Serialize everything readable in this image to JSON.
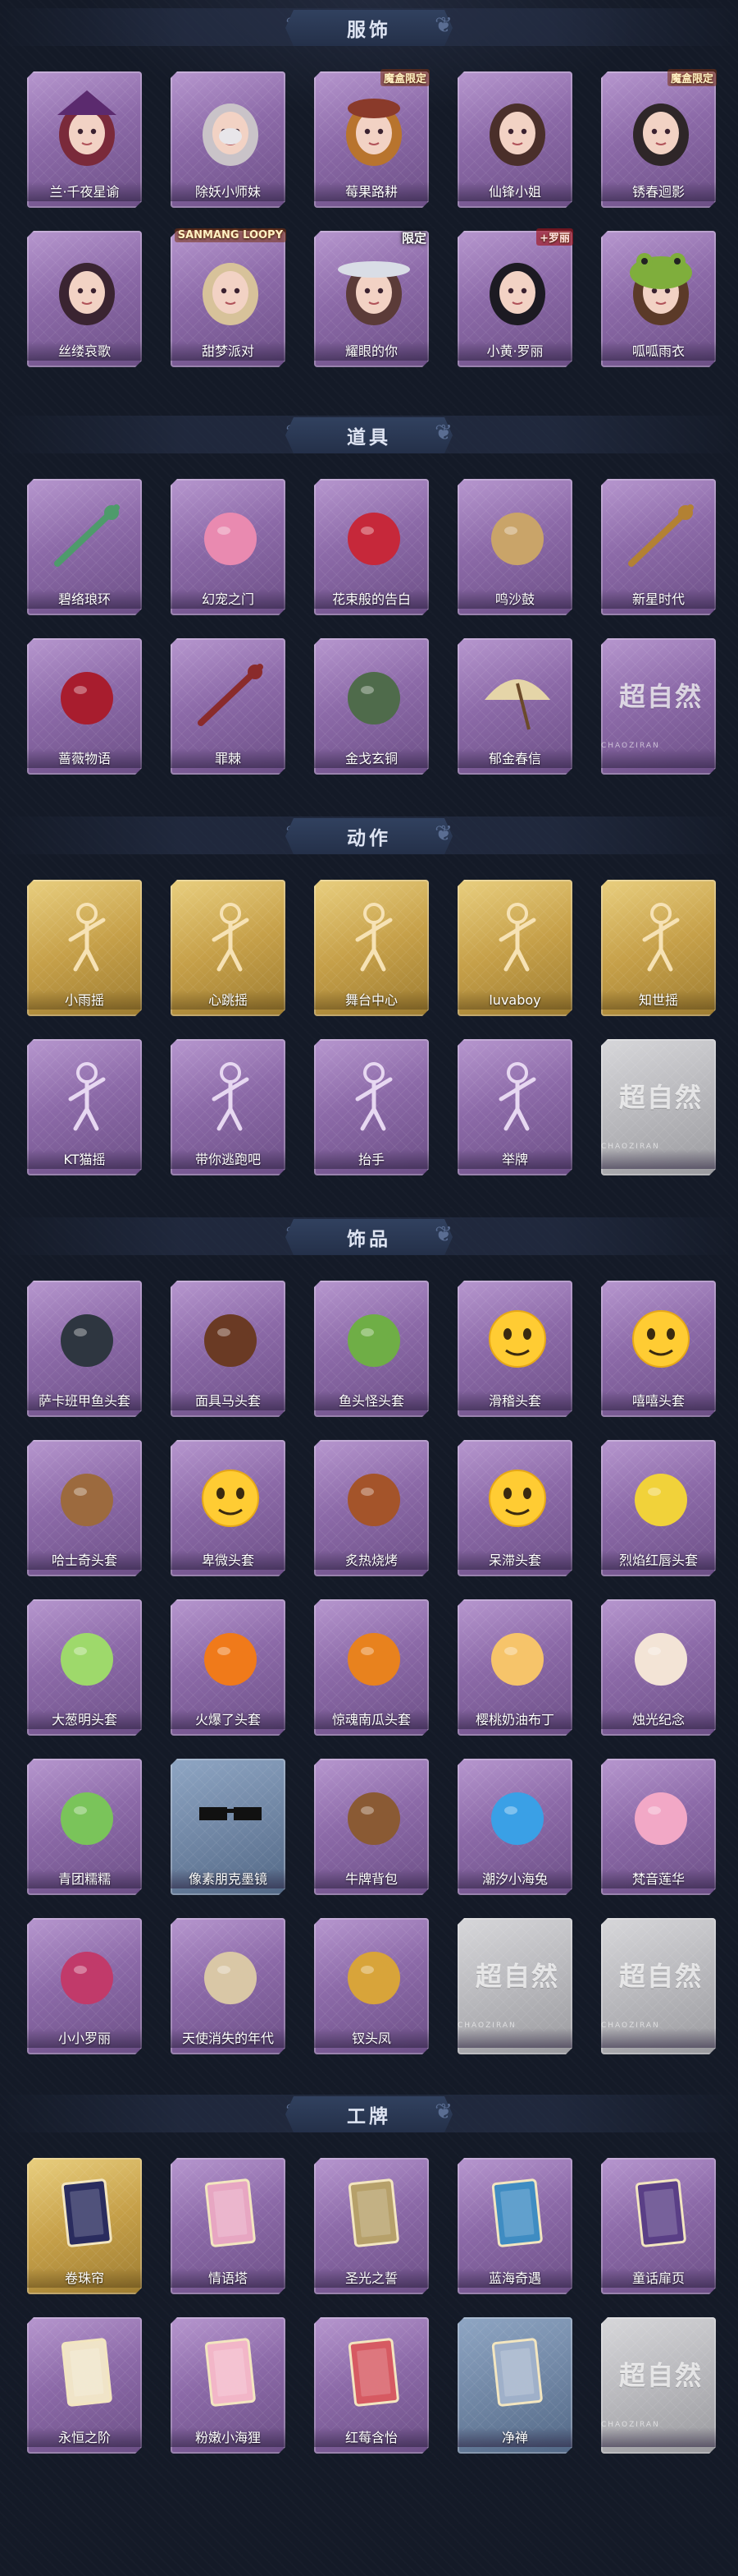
{
  "sections": {
    "costumes": {
      "title": "服饰",
      "items": [
        {
          "label": "兰·千夜星谕",
          "icon": "witch-hat-character-icon",
          "tag": ""
        },
        {
          "label": "除妖小师妹",
          "icon": "silver-hair-character-icon",
          "tag": ""
        },
        {
          "label": "莓果路耕",
          "icon": "berry-hat-character-icon",
          "tag": "魔盒限定"
        },
        {
          "label": "仙锋小姐",
          "icon": "fairy-character-icon",
          "tag": ""
        },
        {
          "label": "锈春迴影",
          "icon": "long-hair-character-icon",
          "tag": "魔盒限定"
        },
        {
          "label": "丝缕哀歌",
          "icon": "gothic-girl-character-icon",
          "tag": ""
        },
        {
          "label": "甜梦派对",
          "icon": "sweet-dream-character-icon",
          "tag": "SANMANG LOOPY"
        },
        {
          "label": "耀眼的你",
          "icon": "cowboy-hat-character-icon",
          "tag": "限定"
        },
        {
          "label": "小黄·罗丽",
          "icon": "black-hair-girl-character-icon",
          "tag": "+罗丽"
        },
        {
          "label": "呱呱雨衣",
          "icon": "frog-hood-character-icon",
          "tag": ""
        }
      ]
    },
    "props": {
      "title": "道具",
      "items": [
        {
          "label": "碧络琅环",
          "icon": "jade-staff-icon"
        },
        {
          "label": "幻宠之门",
          "icon": "pet-device-icon"
        },
        {
          "label": "花束般的告白",
          "icon": "rose-icon"
        },
        {
          "label": "鸣沙鼓",
          "icon": "drum-ornament-icon"
        },
        {
          "label": "新星时代",
          "icon": "revolver-icon"
        },
        {
          "label": "蔷薇物语",
          "icon": "medical-kit-icon"
        },
        {
          "label": "罪棘",
          "icon": "thorn-spear-icon"
        },
        {
          "label": "金戈玄铜",
          "icon": "bronze-lantern-icon"
        },
        {
          "label": "郁金春信",
          "icon": "paper-umbrella-icon"
        },
        {
          "label": "",
          "icon": "locked-placeholder-icon",
          "placeholder": "超自然",
          "placeholder_sub": "CHAOZIRAN"
        }
      ]
    },
    "emotes": {
      "title": "动作",
      "items": [
        {
          "label": "小雨摇",
          "icon": "dance-pose-icon",
          "rarity": "gold"
        },
        {
          "label": "心跳摇",
          "icon": "heart-pose-icon",
          "rarity": "gold"
        },
        {
          "label": "舞台中心",
          "icon": "stage-pose-icon",
          "rarity": "gold"
        },
        {
          "label": "luvaboy",
          "icon": "luvaboy-pose-icon",
          "rarity": "gold"
        },
        {
          "label": "知世摇",
          "icon": "wave-pose-icon",
          "rarity": "gold"
        },
        {
          "label": "KT猫摇",
          "icon": "cat-pose-icon",
          "rarity": "purple"
        },
        {
          "label": "带你逃跑吧",
          "icon": "run-pose-icon",
          "rarity": "purple"
        },
        {
          "label": "抬手",
          "icon": "raise-hand-pose-icon",
          "rarity": "purple"
        },
        {
          "label": "举牌",
          "icon": "hold-sign-pose-icon",
          "rarity": "purple"
        },
        {
          "label": "",
          "icon": "locked-placeholder-icon",
          "rarity": "gray",
          "placeholder": "超自然",
          "placeholder_sub": "CHAOZIRAN"
        }
      ]
    },
    "accessories": {
      "title": "饰品",
      "items": [
        {
          "label": "萨卡班甲鱼头套",
          "icon": "fish-head-icon",
          "rarity": "purple"
        },
        {
          "label": "面具马头套",
          "icon": "horse-head-icon",
          "rarity": "purple"
        },
        {
          "label": "鱼头怪头套",
          "icon": "fish-monster-icon",
          "rarity": "purple"
        },
        {
          "label": "滑稽头套",
          "icon": "funny-face-icon",
          "rarity": "purple"
        },
        {
          "label": "嘻嘻头套",
          "icon": "grin-face-icon",
          "rarity": "purple"
        },
        {
          "label": "哈士奇头套",
          "icon": "husky-head-icon",
          "rarity": "purple"
        },
        {
          "label": "卑微头套",
          "icon": "humble-face-icon",
          "rarity": "purple"
        },
        {
          "label": "炙热烧烤",
          "icon": "bbq-icon",
          "rarity": "purple"
        },
        {
          "label": "呆滞头套",
          "icon": "dazed-face-icon",
          "rarity": "purple"
        },
        {
          "label": "烈焰红唇头套",
          "icon": "pikachu-head-icon",
          "rarity": "purple"
        },
        {
          "label": "大葱明头套",
          "icon": "scallion-head-icon",
          "rarity": "purple"
        },
        {
          "label": "火爆了头套",
          "icon": "fire-head-icon",
          "rarity": "purple"
        },
        {
          "label": "惊魂南瓜头套",
          "icon": "pumpkin-head-icon",
          "rarity": "purple"
        },
        {
          "label": "樱桃奶油布丁",
          "icon": "pudding-icon",
          "rarity": "purple"
        },
        {
          "label": "烛光纪念",
          "icon": "candle-icon",
          "rarity": "purple"
        },
        {
          "label": "青团糯糯",
          "icon": "green-dumpling-icon",
          "rarity": "purple"
        },
        {
          "label": "像素朋克墨镜",
          "icon": "pixel-sunglasses-icon",
          "rarity": "blue"
        },
        {
          "label": "牛牌背包",
          "icon": "cow-backpack-icon",
          "rarity": "purple"
        },
        {
          "label": "潮汐小海兔",
          "icon": "sea-bunny-icon",
          "rarity": "purple"
        },
        {
          "label": "梵音莲华",
          "icon": "lotus-doll-icon",
          "rarity": "purple"
        },
        {
          "label": "小小罗丽",
          "icon": "little-doll-icon",
          "rarity": "purple"
        },
        {
          "label": "天使消失的年代",
          "icon": "angel-doll-icon",
          "rarity": "purple"
        },
        {
          "label": "钗头凤",
          "icon": "phoenix-hairpin-icon",
          "rarity": "purple"
        },
        {
          "label": "",
          "icon": "locked-placeholder-icon",
          "rarity": "gray",
          "placeholder": "超自然",
          "placeholder_sub": "CHAOZIRAN"
        },
        {
          "label": "",
          "icon": "locked-placeholder-icon",
          "rarity": "gray",
          "placeholder": "超自然",
          "placeholder_sub": "CHAOZIRAN"
        }
      ]
    },
    "cards": {
      "title": "工牌",
      "items": [
        {
          "label": "卷珠帘",
          "icon": "curtain-card-icon",
          "rarity": "gold"
        },
        {
          "label": "情语塔",
          "icon": "tower-card-icon",
          "rarity": "purple"
        },
        {
          "label": "圣光之誓",
          "icon": "holy-light-card-icon",
          "rarity": "purple"
        },
        {
          "label": "蓝海奇遇",
          "icon": "blue-sea-card-icon",
          "rarity": "purple"
        },
        {
          "label": "童话扉页",
          "icon": "fairytale-card-icon",
          "rarity": "purple"
        },
        {
          "label": "永恒之阶",
          "icon": "eternal-stair-card-icon",
          "rarity": "purple"
        },
        {
          "label": "粉嫩小海狸",
          "icon": "pink-beaver-card-icon",
          "rarity": "purple"
        },
        {
          "label": "红莓含怡",
          "icon": "red-berry-card-icon",
          "rarity": "purple"
        },
        {
          "label": "净禅",
          "icon": "zen-card-icon",
          "rarity": "blue"
        },
        {
          "label": "",
          "icon": "locked-placeholder-icon",
          "rarity": "gray",
          "placeholder": "超自然",
          "placeholder_sub": "CHAOZIRAN"
        }
      ]
    }
  },
  "colors": {
    "background": "#141a27",
    "banner": "#2b3a57",
    "purple_card": "#8c6aa8",
    "gold_card": "#c6a049",
    "gray_card": "#b5b5b9",
    "blue_card": "#6b819f"
  }
}
